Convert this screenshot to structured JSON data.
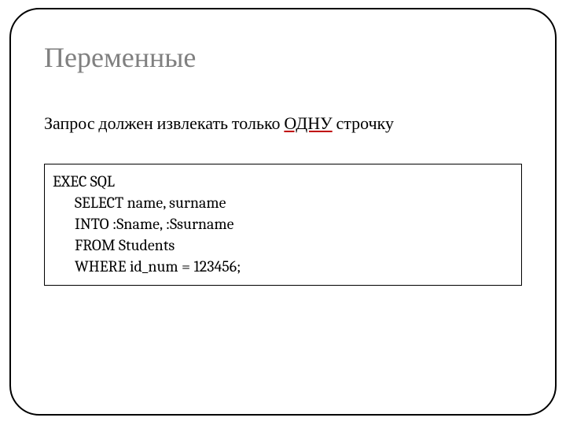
{
  "slide": {
    "title": "Переменные",
    "body_prefix": "Запрос должен извлекать только ",
    "body_underlined": "ОДНУ",
    "body_suffix": " строчку",
    "code": {
      "l1": "EXEC SQL",
      "l2": "SELECT name, surname",
      "l3": "INTO :Sname, :Ssurname",
      "l4": "FROM Students",
      "l5": "WHERE id_num = 123456;"
    }
  }
}
